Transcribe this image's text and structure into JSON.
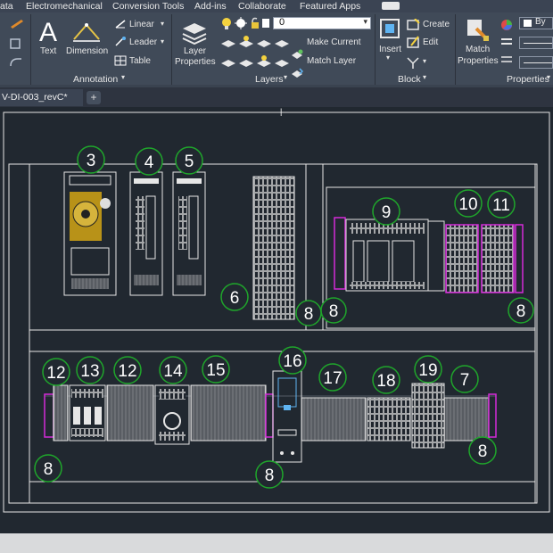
{
  "menu": {
    "items": [
      "ata",
      "Electromechanical",
      "Conversion Tools",
      "Add-ins",
      "Collaborate",
      "Featured Apps"
    ]
  },
  "ribbon": {
    "annotation": {
      "title": "Annotation",
      "text_label": "Text",
      "dimension_label": "Dimension",
      "linear_label": "Linear",
      "leader_label": "Leader",
      "table_label": "Table"
    },
    "layers": {
      "title": "Layers",
      "layer_properties_line1": "Layer",
      "layer_properties_line2": "Properties",
      "current_layer": "0",
      "make_current_label": "Make Current",
      "match_layer_label": "Match Layer"
    },
    "block": {
      "title": "Block",
      "insert_label": "Insert",
      "create_label": "Create",
      "edit_label": "Edit"
    },
    "properties": {
      "title": "Properties",
      "match_properties_line1": "Match",
      "match_properties_line2": "Properties",
      "bylayer_value": "By"
    }
  },
  "document_tab": {
    "label": "V-DI-003_revC*",
    "add_label": "+"
  },
  "drawing": {
    "callouts": {
      "c3": "3",
      "c4": "4",
      "c5": "5",
      "c6": "6",
      "c8a": "8",
      "c8b": "8",
      "c8c": "8",
      "c9": "9",
      "c10": "10",
      "c11": "11",
      "c12a": "12",
      "c13": "13",
      "c12b": "12",
      "c14": "14",
      "c15": "15",
      "c16": "16",
      "c17": "17",
      "c18": "18",
      "c19": "19",
      "c7": "7",
      "c8d": "8",
      "c8e": "8",
      "c8f": "8"
    },
    "colors": {
      "background": "#212830",
      "callout_ring": "#1fa62b",
      "callout_text": "#ffffff",
      "frame": "#e6e6e6",
      "highlight": "#d42ad8"
    }
  }
}
